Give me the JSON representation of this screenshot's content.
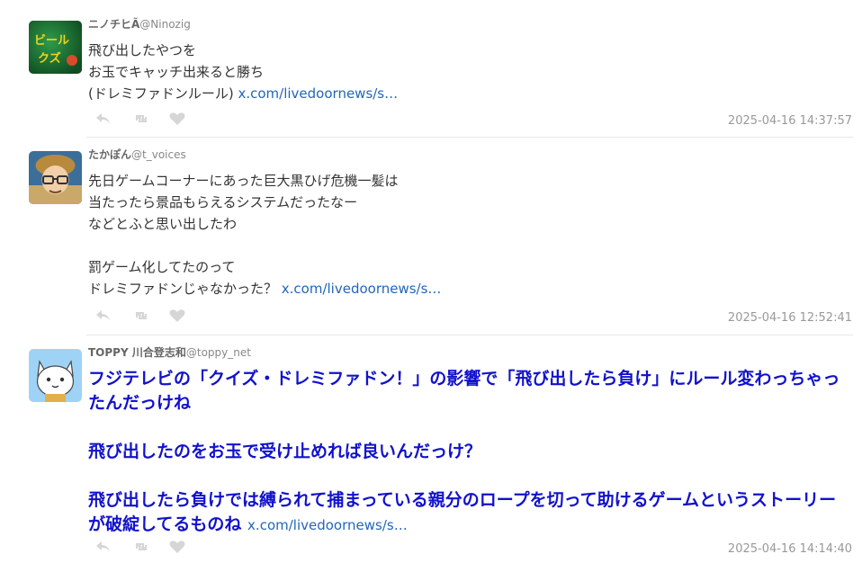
{
  "tweets": [
    {
      "display_name": "ニノチヒÃ",
      "handle": "@Ninozig",
      "text": "飛び出したやつを\nお玉でキャッチ出来ると勝ち\n(ドレミファドンルール) ",
      "link": "x.com/livedoornews/s…",
      "timestamp": "2025-04-16 14:37:57",
      "avatar_text": "ビール\nクズ"
    },
    {
      "display_name": "たかぽん",
      "handle": "@t_voices",
      "text": "先日ゲームコーナーにあった巨大黒ひげ危機一髪は\n当たったら景品もらえるシステムだったなー\nなどとふと思い出したわ\n\n罰ゲーム化してたのって\nドレミファドンじゃなかった？ ",
      "link": "x.com/livedoornews/s…",
      "timestamp": "2025-04-16 12:52:41"
    },
    {
      "display_name": "TOPPY 川合登志和",
      "handle": "@toppy_net",
      "text": "フジテレビの「クイズ・ドレミファドン！」の影響で「飛び出したら負け」にルール変わっちゃったんだっけね\n\n飛び出したのをお玉で受け止めれば良いんだっけ？\n\n飛び出したら負けでは縛られて捕まっている親分のロープを切って助けるゲームというストーリーが破綻してるものね ",
      "link": "x.com/livedoornews/s…",
      "timestamp": "2025-04-16 14:14:40"
    }
  ],
  "icons": [
    "reply-icon",
    "retweet-icon",
    "like-icon"
  ],
  "colors": {
    "link": "#2266bb",
    "bold_text": "#1111cc",
    "timestamp": "#999999"
  }
}
